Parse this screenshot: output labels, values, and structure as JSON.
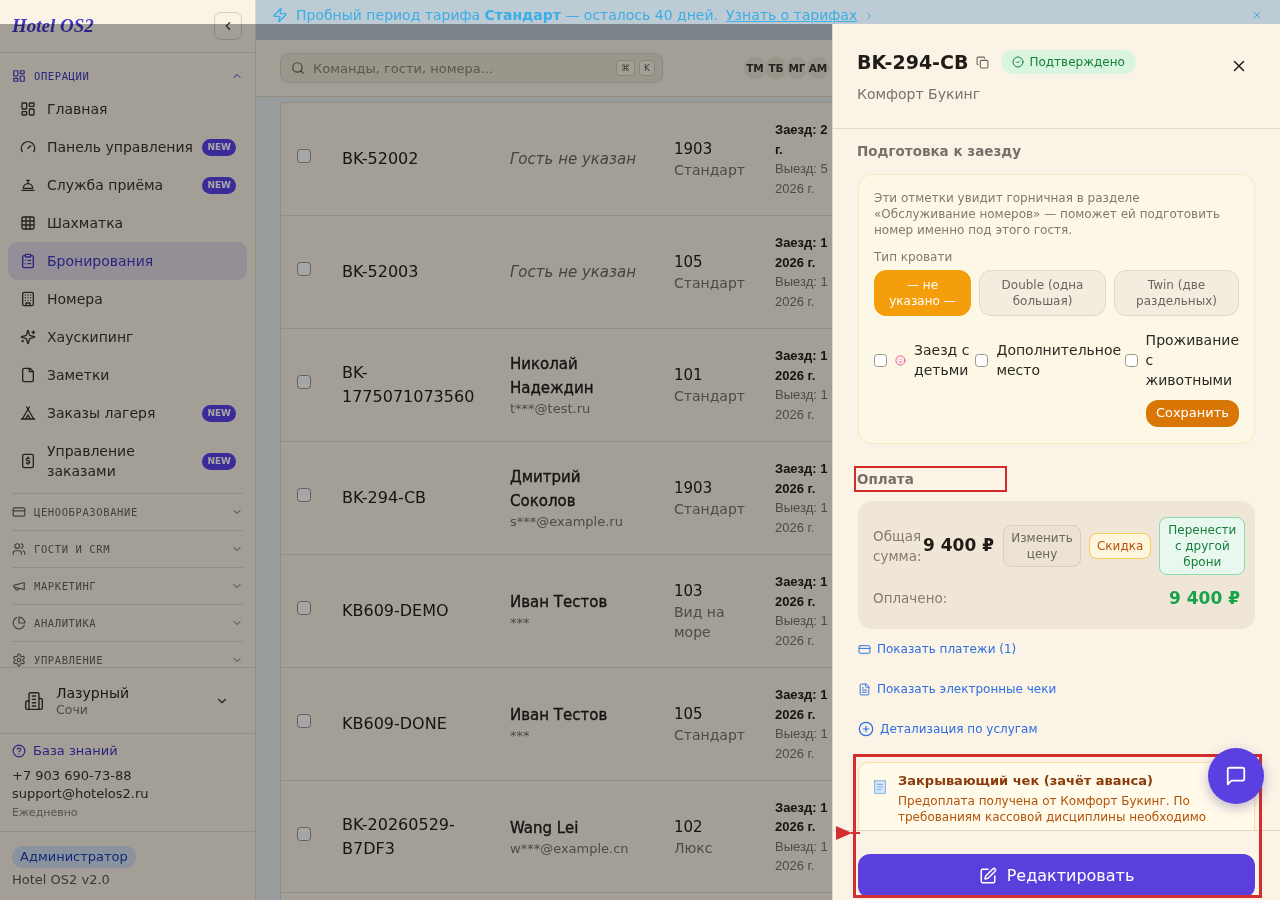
{
  "banner": {
    "text": "Пробный период тарифа **Стандарт** — осталось 40 дней.",
    "link": "Узнать о тарифах"
  },
  "sidebar": {
    "logo": "Hotel OS2",
    "sections": [
      {
        "label": "ОПЕРАЦИИ",
        "expanded": true,
        "items": [
          {
            "label": "Главная",
            "selected": false
          },
          {
            "label": "Панель управления",
            "selected": false,
            "badge": "NEW"
          },
          {
            "label": "Служба приёма",
            "selected": false,
            "badge": "NEW"
          },
          {
            "label": "Шахматка",
            "selected": false
          },
          {
            "label": "Бронирования",
            "selected": true
          },
          {
            "label": "Номера",
            "selected": false
          },
          {
            "label": "Хаускипинг",
            "selected": false
          },
          {
            "label": "Заметки",
            "selected": false
          },
          {
            "label": "Заказы лагеря",
            "selected": false,
            "badge": "NEW"
          },
          {
            "label": "Управление заказами",
            "selected": false,
            "badge": "NEW"
          }
        ]
      },
      {
        "label": "ЦЕНООБРАЗОВАНИЕ",
        "expanded": false
      },
      {
        "label": "ГОСТИ И CRM",
        "expanded": false
      },
      {
        "label": "МАРКЕТИНГ",
        "expanded": false
      },
      {
        "label": "АНАЛИТИКА",
        "expanded": false
      },
      {
        "label": "УПРАВЛЕНИЕ",
        "expanded": false
      }
    ],
    "property": {
      "name": "Лазурный",
      "city": "Сочи"
    },
    "help": {
      "link": "База знаний",
      "phone": "+7 903 690-73-88",
      "email": "support@hotelos2.ru",
      "hours": "Ежедневно"
    },
    "role": "Администратор",
    "version": "Hotel OS2 v2.0"
  },
  "topbar": {
    "search": {
      "placeholder": "Команды, гости, номера...",
      "shortcut": [
        "⌘",
        "K"
      ]
    },
    "avatars": [
      "ТМ",
      "ТБ",
      "МГ",
      "АМ"
    ]
  },
  "bookings": {
    "rows": [
      {
        "checked": false,
        "number": "BK-52002",
        "guest": "Гость не указан",
        "guest_missing": true,
        "room": "1903",
        "room_type": "Стандарт",
        "check_in": [
          "Заезд: 2",
          "г."
        ],
        "check_out": [
          "Выезд: 5",
          "2026 г."
        ]
      },
      {
        "checked": false,
        "number": "BK-52003",
        "guest": "Гость не указан",
        "guest_missing": true,
        "room": "105",
        "room_type": "Стандарт",
        "check_in": [
          "Заезд: 1",
          "2026 г."
        ],
        "check_out": [
          "Выезд: 1",
          "2026 г."
        ]
      },
      {
        "checked": false,
        "number": "BK-1775071073560",
        "guest": "Николай Надеждин",
        "guest_missing": false,
        "email": "t***@test.ru",
        "room": "101",
        "room_type": "Стандарт",
        "check_in": [
          "Заезд: 1",
          "2026 г."
        ],
        "check_out": [
          "Выезд: 1",
          "2026 г."
        ]
      },
      {
        "checked": false,
        "number": "BK-294-CB",
        "guest": "Дмитрий Соколов",
        "guest_missing": false,
        "email": "s***@example.ru",
        "room": "1903",
        "room_type": "Стандарт",
        "check_in": [
          "Заезд: 1",
          "2026 г."
        ],
        "check_out": [
          "Выезд: 1",
          "2026 г."
        ]
      },
      {
        "checked": false,
        "number": "KB609-DEMO",
        "guest": "Иван Тестов",
        "guest_missing": false,
        "email": "***",
        "room": "103",
        "room_type": "Вид на море",
        "check_in": [
          "Заезд: 1",
          "2026 г."
        ],
        "check_out": [
          "Выезд: 1",
          "2026 г."
        ]
      },
      {
        "checked": false,
        "number": "KB609-DONE",
        "guest": "Иван Тестов",
        "guest_missing": false,
        "email": "***",
        "room": "105",
        "room_type": "Стандарт",
        "check_in": [
          "Заезд: 1",
          "2026 г."
        ],
        "check_out": [
          "Выезд: 1",
          "2026 г."
        ]
      },
      {
        "checked": false,
        "number": "BK-20260529-B7DF3",
        "guest": "Wang Lei",
        "guest_missing": false,
        "email": "w***@example.cn",
        "room": "102",
        "room_type": "Люкс",
        "check_in": [
          "Заезд: 1",
          "2026 г."
        ],
        "check_out": [
          "Выезд: 1",
          "2026 г."
        ]
      }
    ]
  },
  "drawer": {
    "title": "BK-294-CB",
    "status": "Подтверждено",
    "source": "Комфорт Букинг",
    "prep": {
      "title": "Подготовка к заезду",
      "note": "Эти отметки увидит горничная в разделе «Обслуживание номеров» — поможет ей подготовить номер именно под этого гостя.",
      "bed_label": "Тип кровати",
      "bed_types": [
        {
          "label": "— не указано —",
          "selected": true
        },
        {
          "label": "Double (одна большая)",
          "selected": false
        },
        {
          "label": "Twin (две раздельных)",
          "selected": false
        }
      ],
      "options": [
        {
          "label": "Заезд с детьми",
          "checked": false
        },
        {
          "label": "Дополнительное место",
          "checked": false
        },
        {
          "label": "Проживание с животными",
          "checked": false
        }
      ],
      "save": "Сохранить"
    },
    "payment": {
      "title": "Оплата",
      "highlighted": true,
      "total_label": "Общая сумма:",
      "total": "9 400 ₽",
      "actions": [
        {
          "label": "Изменить цену",
          "kind": "neutral"
        },
        {
          "label": "Скидка",
          "kind": "discount"
        },
        {
          "label": "Перенести с другой брони",
          "kind": "transfer"
        }
      ],
      "paid_label": "Оплачено:",
      "paid": "9 400 ₽"
    },
    "links": [
      "Показать платежи (1)",
      "Показать электронные чеки",
      "Детализация по услугам"
    ],
    "notice": {
      "title": "Закрывающий чек (зачёт аванса)",
      "text": "Предоплата получена от Комфорт Букинг. По требованиям кассовой дисциплины необходимо"
    },
    "footer": {
      "edit": "Редактировать",
      "highlighted": true
    }
  }
}
